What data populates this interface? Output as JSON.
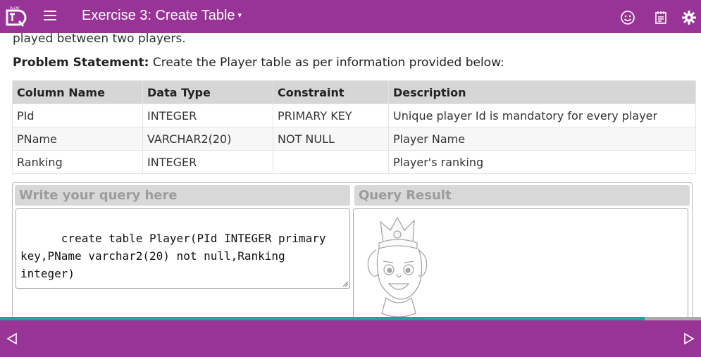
{
  "header": {
    "logo_icon": "tq-logo-icon",
    "menu_icon": "hamburger-menu-icon",
    "title": "Exercise 3: Create Table",
    "title_caret": "▾",
    "icons": [
      "smiley-icon",
      "notepad-icon",
      "gear-icon"
    ]
  },
  "content": {
    "intro_text": "played between two players.",
    "problem_label": "Problem Statement:",
    "problem_text": " Create the Player table as per information provided below:",
    "table": {
      "headers": [
        "Column Name",
        "Data Type",
        "Constraint",
        "Description"
      ],
      "rows": [
        [
          "PId",
          "INTEGER",
          "PRIMARY KEY",
          "Unique player Id is mandatory for every player"
        ],
        [
          "PName",
          "VARCHAR2(20)",
          "NOT NULL",
          "Player Name"
        ],
        [
          "Ranking",
          "INTEGER",
          "",
          "Player's ranking"
        ]
      ]
    }
  },
  "query": {
    "editor_title": "Write your query here",
    "editor_value": "create table Player(PId INTEGER primary key,PName varchar2(20) not null,Ranking integer)",
    "result_title": "Query Result",
    "mascot_icon": "mascot-king-icon"
  },
  "progress": {
    "fraction": 0.92
  },
  "footer": {
    "prev_icon": "prev-arrow-icon",
    "next_icon": "next-arrow-icon"
  },
  "colors": {
    "brand": "#973496",
    "progress": "#20a3a0",
    "panel_head": "#d8d8d8",
    "table_head": "#d6d6d6"
  }
}
